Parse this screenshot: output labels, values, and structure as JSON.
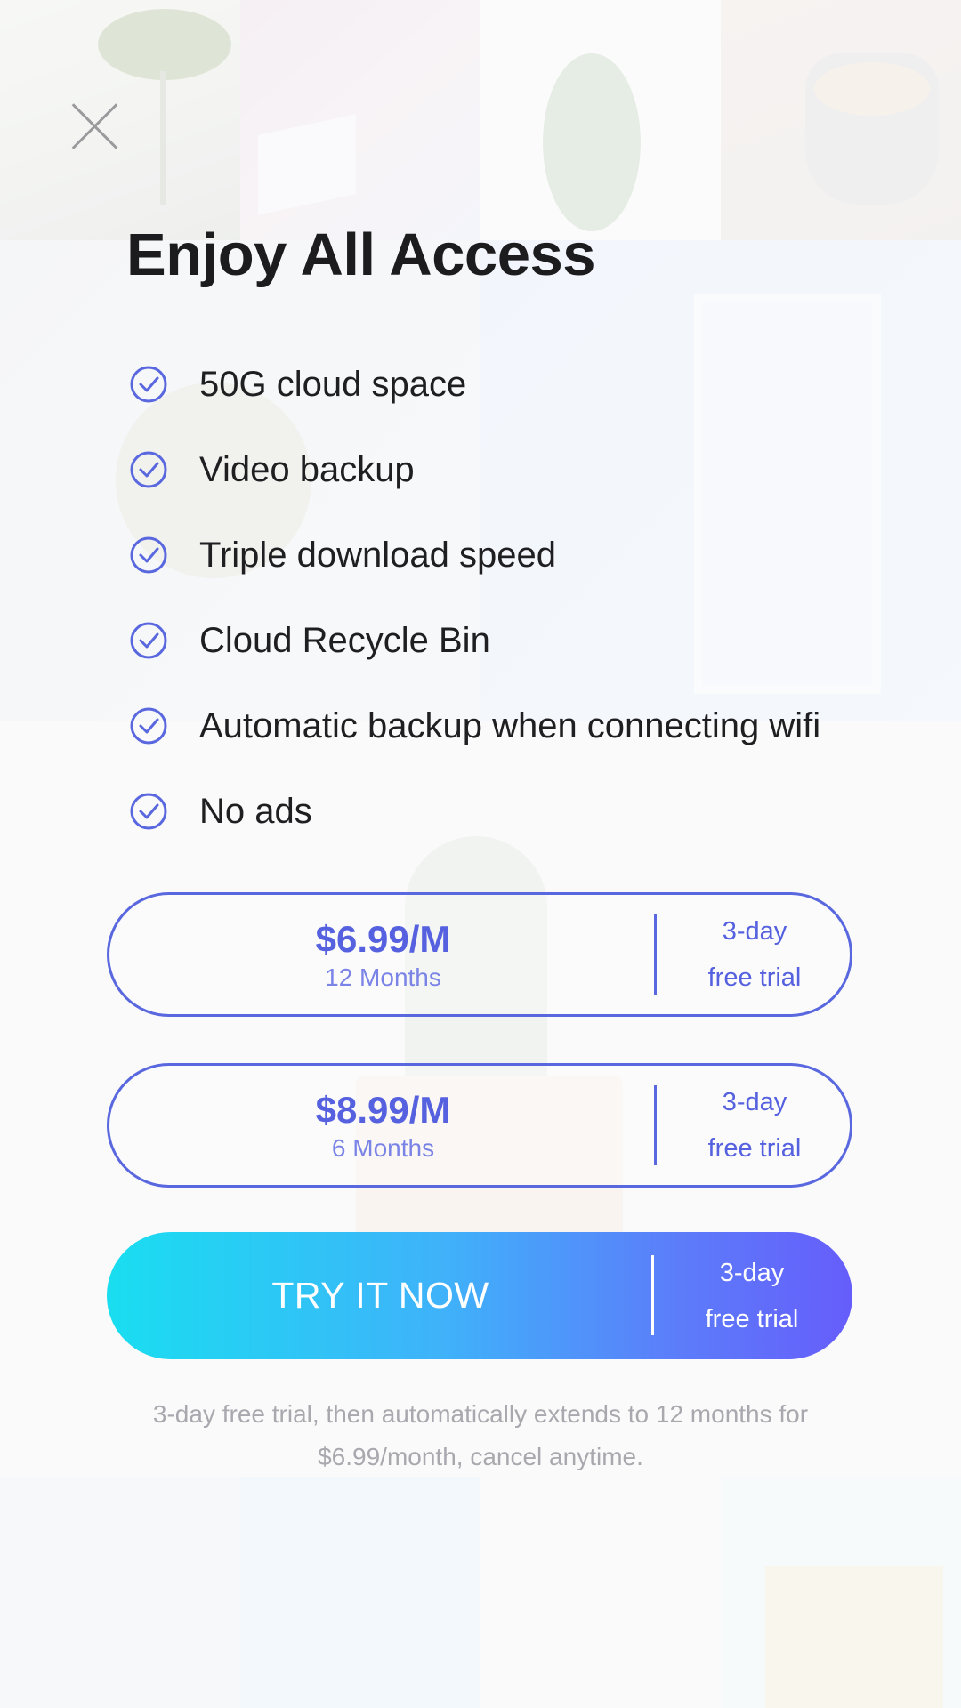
{
  "colors": {
    "accent": "#5a68df",
    "title": "#1c1c1e",
    "cta_gradient_start": "#19def0",
    "cta_gradient_end": "#665dfb",
    "disclaimer": "#a8a8ae"
  },
  "icons": {
    "close": "close-icon",
    "feature_check": "check-circle-icon"
  },
  "header": {
    "title": "Enjoy All Access"
  },
  "features": [
    {
      "label": "50G cloud space"
    },
    {
      "label": "Video backup"
    },
    {
      "label": "Triple download speed"
    },
    {
      "label": "Cloud Recycle Bin"
    },
    {
      "label": "Automatic backup when connecting wifi"
    },
    {
      "label": "No ads"
    }
  ],
  "plans": [
    {
      "price": "$6.99/M",
      "term": "12 Months",
      "trial_line1": "3-day",
      "trial_line2": "free trial"
    },
    {
      "price": "$8.99/M",
      "term": "6 Months",
      "trial_line1": "3-day",
      "trial_line2": "free trial"
    }
  ],
  "cta": {
    "label": "TRY IT NOW",
    "trial_line1": "3-day",
    "trial_line2": "free trial"
  },
  "disclaimer": "3-day free trial, then automatically extends to 12 months for $6.99/month, cancel anytime."
}
